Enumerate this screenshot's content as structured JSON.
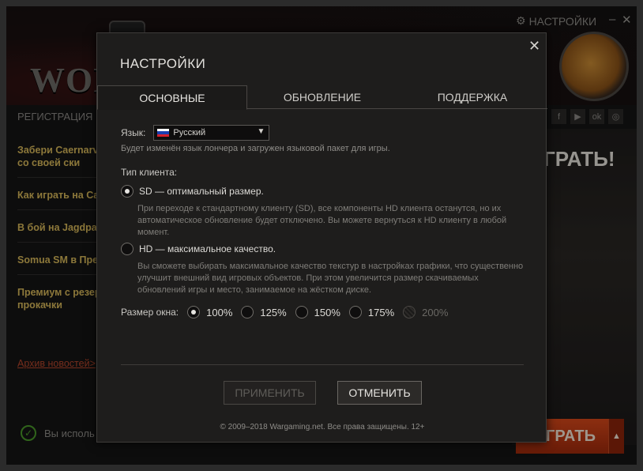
{
  "background": {
    "logo_text": "WORL",
    "top_settings_label": "НАСТРОЙКИ",
    "minimize_label": "–",
    "close_label": "✕",
    "registration_label": "РЕГИСТРАЦИЯ",
    "social_icons": [
      "f",
      "▶",
      "ok",
      "◎"
    ],
    "news": [
      "Забери Caernarvon или со своей ски",
      "Как играть на Cae",
      "В бой на Jagdpan",
      "Somua SM в Прем 40%",
      "Премиум с резер и прокачки"
    ],
    "archive_link": "Архив новостей>",
    "status_text": "Вы исполь",
    "promo_text": "ГРАТЬ!",
    "play_button": "ГРАТЬ",
    "play_arrow": "▲"
  },
  "modal": {
    "title": "НАСТРОЙКИ",
    "close": "✕",
    "tabs": [
      {
        "label": "ОСНОВНЫЕ",
        "active": true
      },
      {
        "label": "ОБНОВЛЕНИЕ",
        "active": false
      },
      {
        "label": "ПОДДЕРЖКА",
        "active": false
      }
    ],
    "language": {
      "label": "Язык:",
      "selected": "Русский",
      "hint": "Будет изменён язык лончера и загружен языковой пакет для игры."
    },
    "client": {
      "title": "Тип клиента:",
      "options": [
        {
          "label": "SD — оптимальный размер.",
          "selected": true,
          "description": "При переходе к стандартному клиенту (SD), все компоненты HD клиента останутся, но их автоматическое обновление будет отключено. Вы можете вернуться к HD клиенту в любой момент."
        },
        {
          "label": "HD — максимальное качество.",
          "selected": false,
          "description": "Вы сможете выбирать максимальное качество текстур в настройках графики, что существенно улучшит внешний вид игровых объектов. При этом увеличится размер скачиваемых обновлений игры и место, занимаемое на жёстком диске."
        }
      ]
    },
    "window_size": {
      "label": "Размер окна:",
      "options": [
        {
          "label": "100%",
          "selected": true,
          "enabled": true
        },
        {
          "label": "125%",
          "selected": false,
          "enabled": true
        },
        {
          "label": "150%",
          "selected": false,
          "enabled": true
        },
        {
          "label": "175%",
          "selected": false,
          "enabled": true
        },
        {
          "label": "200%",
          "selected": false,
          "enabled": false
        }
      ]
    },
    "buttons": {
      "apply": "ПРИМЕНИТЬ",
      "cancel": "ОТМЕНИТЬ"
    },
    "copyright": "© 2009–2018 Wargaming.net. Все права защищены. 12+"
  },
  "colors": {
    "accent_orange": "#d8481a",
    "news_gold": "#d8b85a",
    "link_red": "#b5462c",
    "ok_green": "#4a9a2a"
  }
}
